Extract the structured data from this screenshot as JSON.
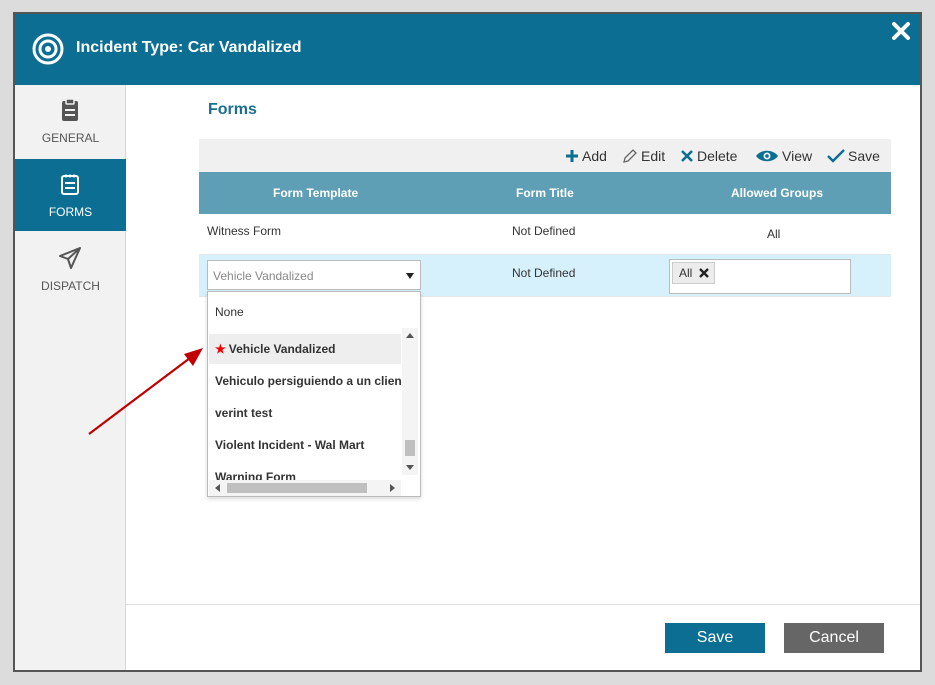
{
  "header": {
    "title": "Incident Type: Car Vandalized"
  },
  "sidebar": {
    "items": [
      {
        "label": "GENERAL",
        "icon": "clipboard-icon"
      },
      {
        "label": "FORMS",
        "icon": "notepad-icon"
      },
      {
        "label": "DISPATCH",
        "icon": "paper-plane-icon"
      }
    ]
  },
  "section": {
    "title": "Forms"
  },
  "toolbar": {
    "add": "Add",
    "edit": "Edit",
    "delete": "Delete",
    "view": "View",
    "save": "Save"
  },
  "grid": {
    "columns": [
      "Form Template",
      "Form Title",
      "Allowed Groups"
    ],
    "rows": [
      {
        "template": "Witness Form",
        "title": "Not Defined",
        "groups": "All"
      },
      {
        "template": "Vehicle Vandalized",
        "title": "Not Defined",
        "group_tag": "All"
      }
    ]
  },
  "dropdown": {
    "none_label": "None",
    "options": [
      "Vehicle Vandalized",
      "Vehiculo persiguiendo a un cliente",
      "verint test",
      "Violent Incident - Wal Mart",
      "Warning Form"
    ]
  },
  "footer": {
    "save": "Save",
    "cancel": "Cancel"
  },
  "colors": {
    "accent": "#0b6e92",
    "grid_header": "#5f9fb5",
    "selected_row": "#d6f1fb",
    "annotation_arrow": "#c00000"
  }
}
